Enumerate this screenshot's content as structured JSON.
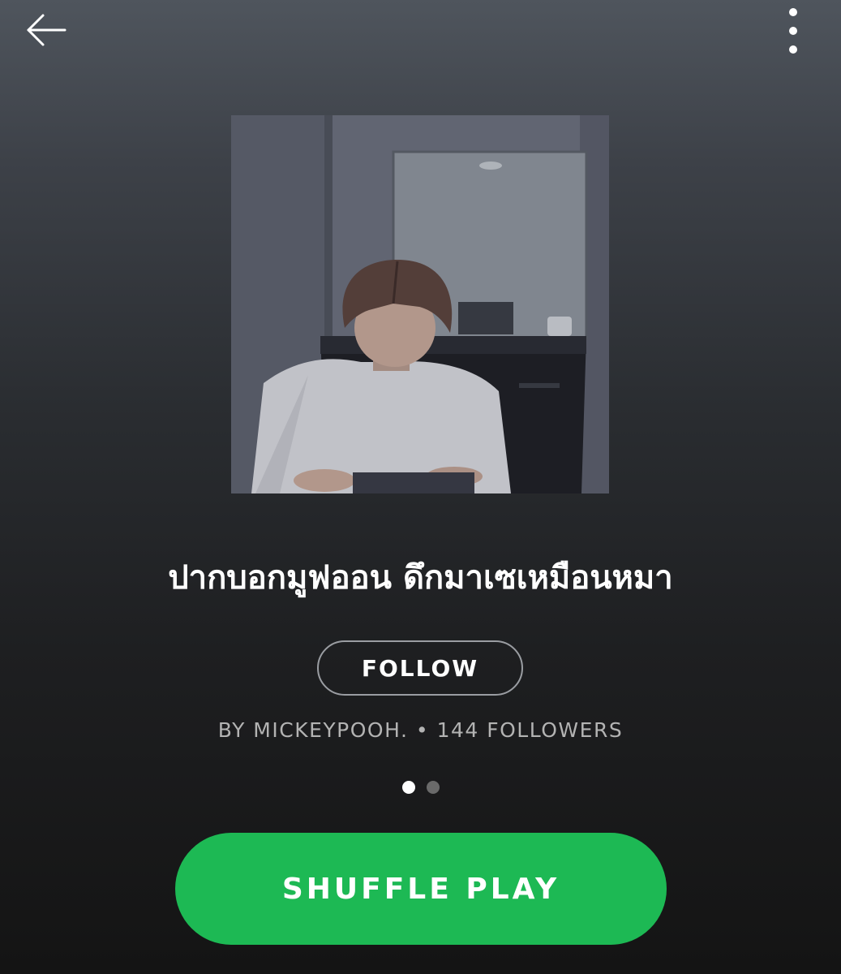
{
  "header": {
    "back_icon": "arrow-left-icon",
    "more_icon": "more-vertical-icon"
  },
  "playlist": {
    "cover_alt": "playlist-cover",
    "title": "ปากบอกมูฟออน ดึกมาเซเหมือนหมา",
    "follow_label": "FOLLOW",
    "owner": "BY MICKEYPOOH.",
    "separator": "•",
    "followers": "144 FOLLOWERS"
  },
  "pager": {
    "pages": [
      "page-1",
      "page-2"
    ],
    "active_index": 0
  },
  "actions": {
    "shuffle_label": "SHUFFLE PLAY"
  },
  "colors": {
    "accent": "#1db954",
    "background_top": "#4f555d",
    "background_bottom": "#141414",
    "secondary_text": "#b3b3b3"
  }
}
